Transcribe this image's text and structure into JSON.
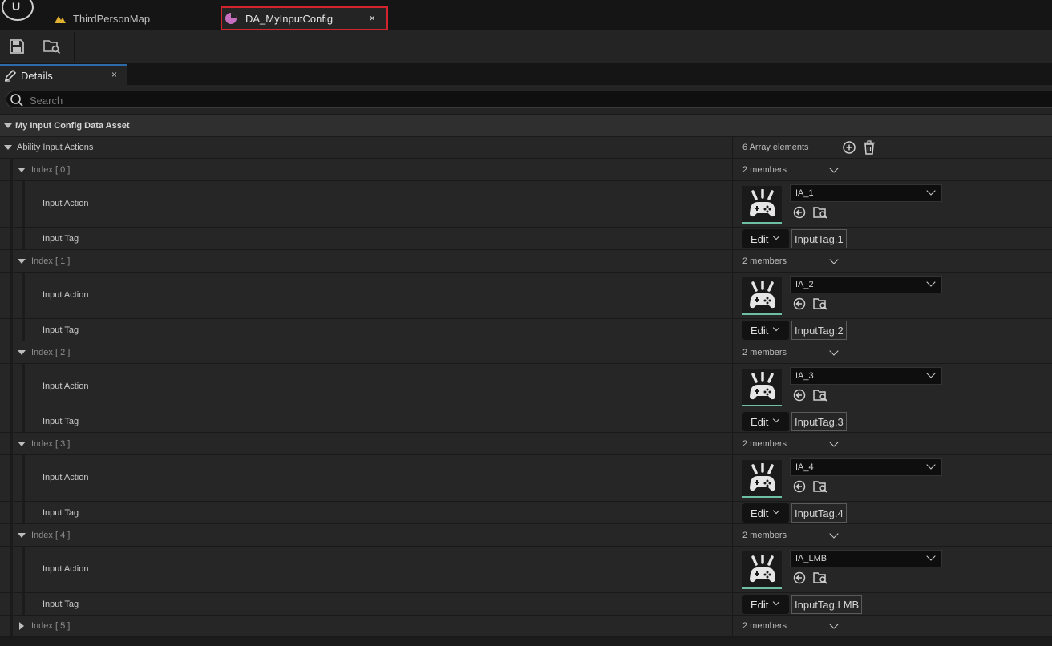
{
  "titlebar": {
    "map_tab_label": "ThirdPersonMap",
    "asset_tab_label": "DA_MyInputConfig",
    "close_glyph": "×"
  },
  "panel": {
    "tab_label": "Details",
    "close_glyph": "×"
  },
  "search": {
    "placeholder": "Search"
  },
  "category": {
    "label": "My Input Config Data Asset"
  },
  "array": {
    "label": "Ability Input Actions",
    "count_text": "6 Array elements",
    "entries": [
      {
        "index_label": "Index [ 0 ]",
        "members_text": "2 members",
        "action_label": "Input Action",
        "action_value": "IA_1",
        "tag_label": "Input Tag",
        "edit_label": "Edit",
        "tag_value": "InputTag.1"
      },
      {
        "index_label": "Index [ 1 ]",
        "members_text": "2 members",
        "action_label": "Input Action",
        "action_value": "IA_2",
        "tag_label": "Input Tag",
        "edit_label": "Edit",
        "tag_value": "InputTag.2"
      },
      {
        "index_label": "Index [ 2 ]",
        "members_text": "2 members",
        "action_label": "Input Action",
        "action_value": "IA_3",
        "tag_label": "Input Tag",
        "edit_label": "Edit",
        "tag_value": "InputTag.3"
      },
      {
        "index_label": "Index [ 3 ]",
        "members_text": "2 members",
        "action_label": "Input Action",
        "action_value": "IA_4",
        "tag_label": "Input Tag",
        "edit_label": "Edit",
        "tag_value": "InputTag.4"
      },
      {
        "index_label": "Index [ 4 ]",
        "members_text": "2 members",
        "action_label": "Input Action",
        "action_value": "IA_LMB",
        "tag_label": "Input Tag",
        "edit_label": "Edit",
        "tag_value": "InputTag.LMB"
      }
    ],
    "collapsed_entry": {
      "index_label": "Index [ 5 ]",
      "members_text": "2 members"
    }
  },
  "icons": {
    "logo": "unreal-logo-icon",
    "map": "level-map-icon",
    "asset": "data-asset-icon",
    "save": "save-icon",
    "browse": "browse-folder-icon",
    "details": "pencil-icon",
    "search": "search-icon",
    "add": "add-element-icon",
    "delete": "trash-icon",
    "thumbnail": "gamepad-icon",
    "use_selected": "use-selected-arrow-icon",
    "browse_asset": "browse-asset-icon"
  },
  "colors": {
    "highlight_border": "#d1242c",
    "asset_icon": "#c66fc0",
    "map_icon": "#e0b030",
    "thumbnail_accent": "#6fbfa5"
  }
}
